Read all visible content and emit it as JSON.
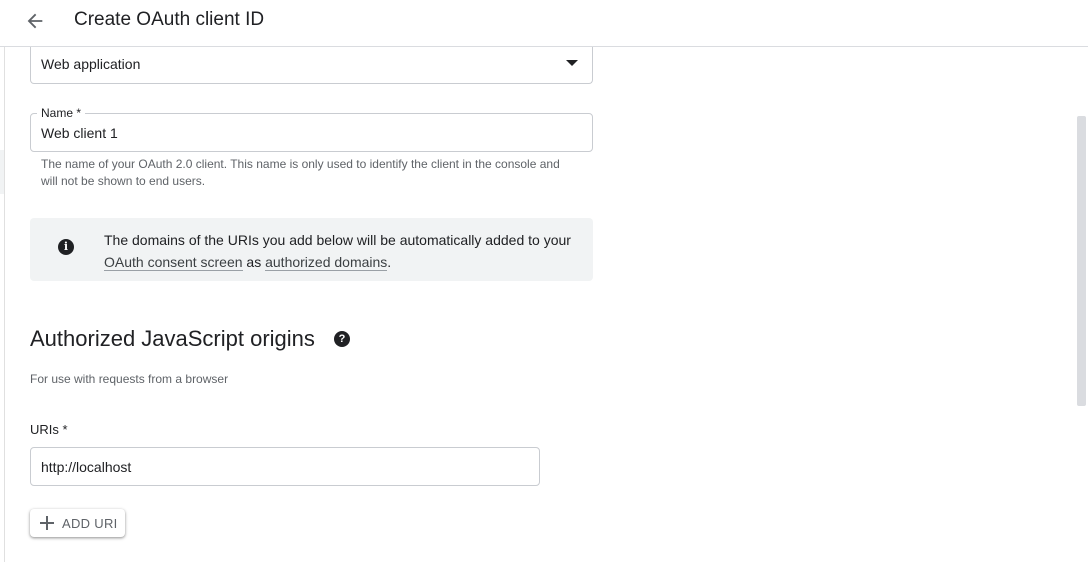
{
  "header": {
    "title": "Create OAuth client ID",
    "back_icon": "arrow-back-icon"
  },
  "form": {
    "application_type": {
      "value": "Web application"
    },
    "name": {
      "label": "Name *",
      "value": "Web client 1",
      "helper": "The name of your OAuth 2.0 client. This name is only used to identify the client in the console and will not be shown to end users."
    },
    "info": {
      "icon": "info-icon",
      "text_before": "The domains of the URIs you add below will be automatically added to your ",
      "link1": "OAuth consent screen",
      "text_middle": " as ",
      "link2": "authorized domains",
      "text_after": "."
    },
    "origins": {
      "title": "Authorized JavaScript origins",
      "help_icon": "help-icon",
      "subtitle": "For use with requests from a browser",
      "uris_label": "URIs *",
      "uri_value": "http://localhost",
      "add_button": "ADD URI"
    }
  },
  "colors": {
    "text": "#202124",
    "secondary_text": "#5f6368",
    "border": "#c9ccd1",
    "info_background": "#f1f3f4"
  }
}
